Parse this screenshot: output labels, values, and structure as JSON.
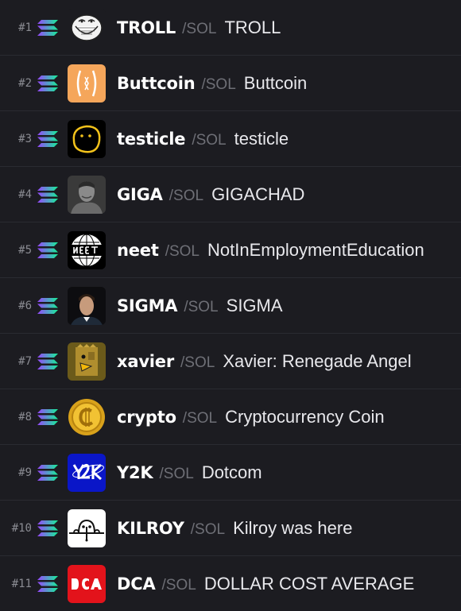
{
  "colors": {
    "background": "#1c1c21",
    "divider": "#2a2b31",
    "rank_text": "#8a8b92",
    "symbol_text": "#ffffff",
    "quote_text": "#6e6f76",
    "name_text": "#e8e8ec",
    "solana_gradient": [
      "#9945FF",
      "#14F195"
    ]
  },
  "tokens": [
    {
      "rank": "#1",
      "chain_icon": "solana-icon",
      "avatar_icon": "troll-face-icon",
      "symbol": "TROLL",
      "quote": "/SOL",
      "name": "TROLL"
    },
    {
      "rank": "#2",
      "chain_icon": "solana-icon",
      "avatar_icon": "buttcoin-icon",
      "symbol": "Buttcoin",
      "quote": "/SOL",
      "name": "Buttcoin"
    },
    {
      "rank": "#3",
      "chain_icon": "solana-icon",
      "avatar_icon": "testicle-face-icon",
      "symbol": "testicle",
      "quote": "/SOL",
      "name": "testicle"
    },
    {
      "rank": "#4",
      "chain_icon": "solana-icon",
      "avatar_icon": "gigachad-icon",
      "symbol": "GIGA",
      "quote": "/SOL",
      "name": "GIGACHAD"
    },
    {
      "rank": "#5",
      "chain_icon": "solana-icon",
      "avatar_icon": "neet-globe-icon",
      "symbol": "neet",
      "quote": "/SOL",
      "name": "NotInEmploymentEducation"
    },
    {
      "rank": "#6",
      "chain_icon": "solana-icon",
      "avatar_icon": "sigma-portrait-icon",
      "symbol": "SIGMA",
      "quote": "/SOL",
      "name": "SIGMA"
    },
    {
      "rank": "#7",
      "chain_icon": "solana-icon",
      "avatar_icon": "xavier-icon",
      "symbol": "xavier",
      "quote": "/SOL",
      "name": "Xavier: Renegade Angel"
    },
    {
      "rank": "#8",
      "chain_icon": "solana-icon",
      "avatar_icon": "crypto-coin-icon",
      "symbol": "crypto",
      "quote": "/SOL",
      "name": "Cryptocurrency Coin"
    },
    {
      "rank": "#9",
      "chain_icon": "solana-icon",
      "avatar_icon": "y2k-logo-icon",
      "symbol": "Y2K",
      "quote": "/SOL",
      "name": "Dotcom"
    },
    {
      "rank": "#10",
      "chain_icon": "solana-icon",
      "avatar_icon": "kilroy-icon",
      "symbol": "KILROY",
      "quote": "/SOL",
      "name": "Kilroy was here"
    },
    {
      "rank": "#11",
      "chain_icon": "solana-icon",
      "avatar_icon": "dca-logo-icon",
      "symbol": "DCA",
      "quote": "/SOL",
      "name": "DOLLAR COST AVERAGE"
    }
  ]
}
